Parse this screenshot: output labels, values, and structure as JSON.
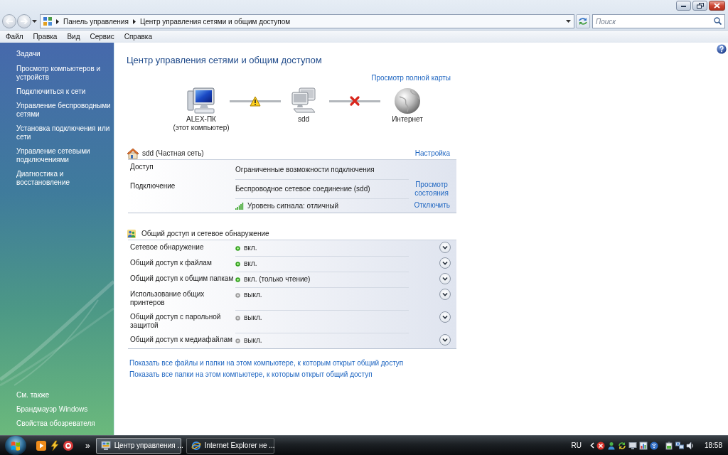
{
  "address_bar": {
    "nav_buttons": [
      {
        "kind": "back",
        "disabled": true
      },
      {
        "kind": "forward",
        "disabled": true
      }
    ],
    "breadcrumbs": [
      "Панель управления",
      "Центр управления сетями и общим доступом"
    ]
  },
  "search": {
    "placeholder": "Поиск"
  },
  "menu": [
    "Файл",
    "Правка",
    "Вид",
    "Сервис",
    "Справка"
  ],
  "sidebar": {
    "tasks_heading": "Задачи",
    "tasks": [
      "Просмотр компьютеров и устройств",
      "Подключиться к сети",
      "Управление беспроводными сетями",
      "Установка подключения или сети",
      "Управление сетевыми подключениями",
      "Диагностика и восстановление"
    ],
    "see_also_heading": "См. также",
    "see_also": [
      "Брандмауэр Windows",
      "Свойства обозревателя"
    ]
  },
  "page": {
    "title": "Центр управления сетями и общим доступом",
    "full_map_link": "Просмотр полной карты"
  },
  "network_map": {
    "nodes": [
      {
        "kind": "computer",
        "name": "ALEX-ПК",
        "note": "(этот компьютер)"
      },
      {
        "kind": "network",
        "name": "sdd"
      },
      {
        "kind": "internet",
        "name": "Интернет"
      }
    ],
    "connections": [
      {
        "kind": "warning"
      },
      {
        "kind": "disconnected"
      }
    ]
  },
  "network": {
    "name": "sdd (Частная сеть)",
    "settings_link": "Настройка",
    "rows": [
      {
        "kind": "plain",
        "label": "Доступ",
        "value": "Ограниченные возможности подключения"
      },
      {
        "kind": "plain",
        "label": "Подключение",
        "value": "Беспроводное сетевое соединение (sdd)",
        "link": "Просмотр состояния"
      },
      {
        "kind": "signal",
        "value": "Уровень сигнала: отличный",
        "link": "Отключить"
      }
    ]
  },
  "sharing": {
    "title": "Общий доступ и сетевое обнаружение",
    "rows": [
      {
        "label": "Сетевое обнаружение",
        "status": "вкл.",
        "on": true,
        "expanded": false
      },
      {
        "label": "Общий доступ к файлам",
        "status": "вкл.",
        "on": true,
        "expanded": false
      },
      {
        "label": "Общий доступ к общим папкам",
        "status": "вкл. (только чтение)",
        "on": true,
        "expanded": false
      },
      {
        "label": "Использование общих принтеров",
        "status": "выкл.",
        "on": false,
        "expanded": false
      },
      {
        "label": "Общий доступ с парольной защитой",
        "status": "выкл.",
        "on": false,
        "expanded": false
      },
      {
        "label": "Общий доступ к медиафайлам",
        "status": "выкл.",
        "on": false,
        "expanded": false
      }
    ]
  },
  "links": [
    "Показать все файлы и папки на этом компьютере, к которым открыт общий доступ",
    "Показать все папки на этом компьютере, к которым открыт общий доступ"
  ],
  "taskbar": {
    "quick_launch_more": "»",
    "tasks": [
      {
        "kind": "network",
        "label": "Центр управления ...",
        "selected": true
      },
      {
        "kind": "browser",
        "label": "Internet Explorer не ...",
        "selected": false
      }
    ],
    "language": "RU",
    "clock": "18:58"
  }
}
